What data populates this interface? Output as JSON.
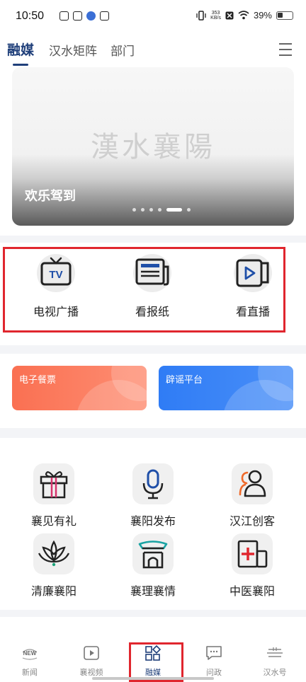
{
  "status_bar": {
    "time": "10:50",
    "net_speed_value": "353",
    "net_speed_unit": "KB/s",
    "battery": "39%",
    "battery_level": 0.39
  },
  "tabs": [
    {
      "label": "融媒",
      "active": true
    },
    {
      "label": "汉水矩阵",
      "active": false
    },
    {
      "label": "部门",
      "active": false
    }
  ],
  "banner": {
    "watermark": "漢水襄陽",
    "caption": "欢乐驾到",
    "page_count": 6,
    "active_page": 5
  },
  "media": [
    {
      "label": "电视广播",
      "icon": "tv-icon"
    },
    {
      "label": "看报纸",
      "icon": "newspaper-icon"
    },
    {
      "label": "看直播",
      "icon": "live-stream-icon"
    }
  ],
  "cards": [
    {
      "label": "电子餐票",
      "color": "#fa7052",
      "icon": "card-bubble"
    },
    {
      "label": "辟谣平台",
      "color": "#2f7cf5",
      "icon": "card-bubble"
    }
  ],
  "apps": [
    {
      "label": "襄见有礼",
      "icon": "gift-icon"
    },
    {
      "label": "襄阳发布",
      "icon": "microphone-icon"
    },
    {
      "label": "汉江创客",
      "icon": "people-icon"
    },
    {
      "label": "清廉襄阳",
      "icon": "lotus-icon"
    },
    {
      "label": "襄理襄情",
      "icon": "gate-icon"
    },
    {
      "label": "中医襄阳",
      "icon": "medical-cross-icon"
    }
  ],
  "bottom_nav": [
    {
      "label": "新闻",
      "icon": "new-icon",
      "badge_text": "NEW",
      "active": false
    },
    {
      "label": "襄视频",
      "icon": "video-play-icon",
      "active": false
    },
    {
      "label": "融媒",
      "icon": "grid-icon",
      "active": true
    },
    {
      "label": "问政",
      "icon": "chat-icon",
      "active": false
    },
    {
      "label": "汉水号",
      "icon": "waves-icon",
      "active": false
    }
  ],
  "colors": {
    "accent": "#1f3f7a",
    "highlight_border": "#e0262e"
  }
}
